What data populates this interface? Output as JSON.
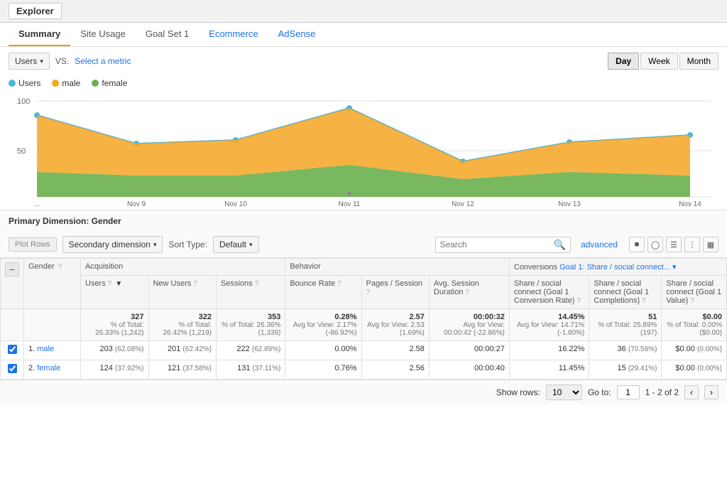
{
  "topBar": {
    "title": "Explorer"
  },
  "tabs": [
    {
      "label": "Summary",
      "active": true,
      "colored": false
    },
    {
      "label": "Site Usage",
      "active": false,
      "colored": false
    },
    {
      "label": "Goal Set 1",
      "active": false,
      "colored": false
    },
    {
      "label": "Ecommerce",
      "active": false,
      "colored": true
    },
    {
      "label": "AdSense",
      "active": false,
      "colored": true
    }
  ],
  "controls": {
    "dimension": "Users",
    "vs_label": "VS.",
    "select_metric": "Select a metric",
    "period_buttons": [
      "Day",
      "Week",
      "Month"
    ],
    "active_period": "Day"
  },
  "legend": [
    {
      "label": "Users",
      "color": "#4db6e0"
    },
    {
      "label": "male",
      "color": "#f5a623"
    },
    {
      "label": "female",
      "color": "#6ab04c"
    }
  ],
  "chart": {
    "y_label": "100",
    "y_mid": "50",
    "x_labels": [
      "...",
      "Nov 9",
      "Nov 10",
      "Nov 11",
      "Nov 12",
      "Nov 13",
      "Nov 14"
    ]
  },
  "primaryDimension": {
    "label": "Primary Dimension:",
    "value": "Gender"
  },
  "tableControls": {
    "plot_rows": "Plot Rows",
    "secondary_dimension": "Secondary dimension",
    "sort_type": "Sort Type:",
    "sort_default": "Default",
    "search_placeholder": "Search",
    "advanced": "advanced"
  },
  "tableHeaders": {
    "acquisition": "Acquisition",
    "behavior": "Behavior",
    "conversions": "Conversions",
    "goal": "Goal 1: Share / social connect...",
    "cols": [
      {
        "label": "Gender",
        "sub": ""
      },
      {
        "label": "Users",
        "sub": "",
        "sort": true
      },
      {
        "label": "New Users",
        "sub": "?"
      },
      {
        "label": "Sessions",
        "sub": "?"
      },
      {
        "label": "Bounce Rate",
        "sub": "?"
      },
      {
        "label": "Pages / Session",
        "sub": "?"
      },
      {
        "label": "Avg. Session Duration",
        "sub": "?"
      },
      {
        "label": "Share / social connect (Goal 1 Conversion Rate)",
        "sub": "?"
      },
      {
        "label": "Share / social connect (Goal 1 Completions)",
        "sub": "?"
      },
      {
        "label": "Share / social connect (Goal 1 Value)",
        "sub": "?"
      }
    ]
  },
  "totalRow": {
    "users": "327",
    "users_sub": "% of Total: 26.33% (1,242)",
    "new_users": "322",
    "new_users_sub": "% of Total: 26.42% (1,219)",
    "sessions": "353",
    "sessions_sub": "% of Total: 26.36% (1,339)",
    "bounce_rate": "0.28%",
    "bounce_sub": "Avg for View: 2.17% (-86.92%)",
    "pages_session": "2.57",
    "pages_sub": "Avg for View: 2.53 (1.69%)",
    "avg_duration": "00:00:32",
    "duration_sub": "Avg for View: 00:00:42 (-22.86%)",
    "conversion_rate": "14.45%",
    "conversion_sub": "Avg for View: 14.71% (-1.80%)",
    "completions": "51",
    "completions_sub": "% of Total: 25.89% (197)",
    "goal_value": "$0.00",
    "goal_value_sub": "% of Total: 0.00% ($0.00)"
  },
  "rows": [
    {
      "num": "1.",
      "gender": "male",
      "users": "203",
      "users_pct": "(62.08%)",
      "new_users": "201",
      "new_users_pct": "(62.42%)",
      "sessions": "222",
      "sessions_pct": "(62.89%)",
      "bounce_rate": "0.00%",
      "pages_session": "2.58",
      "avg_duration": "00:00:27",
      "conversion_rate": "16.22%",
      "completions": "36",
      "completions_pct": "(70.59%)",
      "goal_value": "$0.00",
      "goal_value_pct": "(0.00%)",
      "checked": true
    },
    {
      "num": "2.",
      "gender": "female",
      "users": "124",
      "users_pct": "(37.92%)",
      "new_users": "121",
      "new_users_pct": "(37.58%)",
      "sessions": "131",
      "sessions_pct": "(37.11%)",
      "bounce_rate": "0.76%",
      "pages_session": "2.56",
      "avg_duration": "00:00:40",
      "conversion_rate": "11.45%",
      "completions": "15",
      "completions_pct": "(29.41%)",
      "goal_value": "$0.00",
      "goal_value_pct": "(0.00%)",
      "checked": true
    }
  ],
  "footer": {
    "show_rows_label": "Show rows:",
    "rows_value": "10",
    "go_to_label": "Go to:",
    "go_to_value": "1",
    "range": "1 - 2 of 2"
  }
}
